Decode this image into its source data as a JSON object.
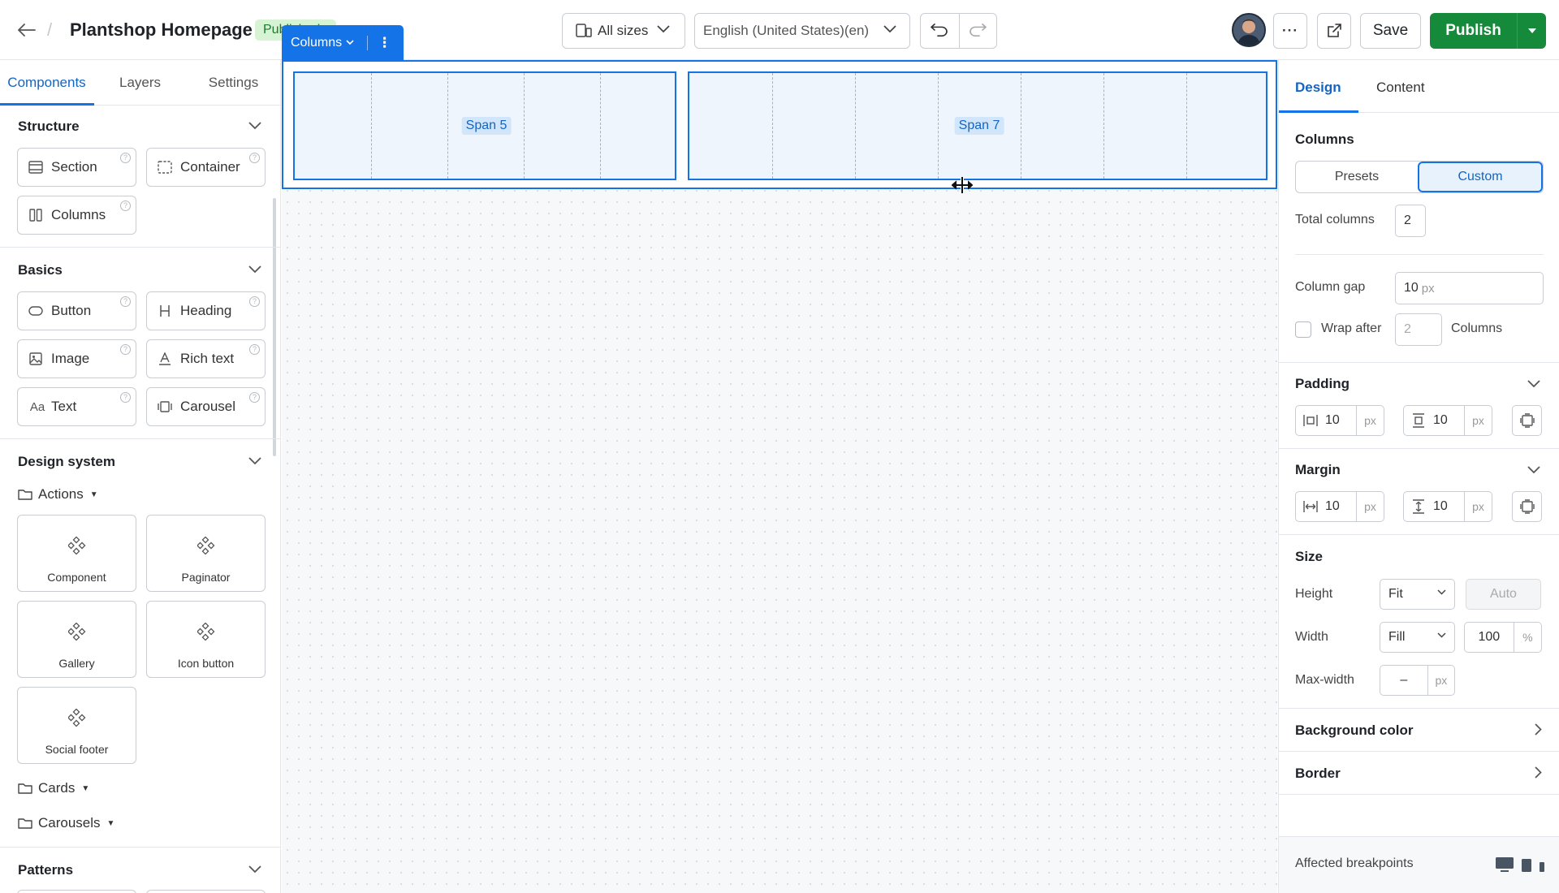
{
  "header": {
    "title": "Plantshop Homepage",
    "status": "Published",
    "selection_label": "Columns",
    "sizes": "All sizes",
    "language": "English (United States)(en)",
    "save": "Save",
    "publish": "Publish"
  },
  "left": {
    "tabs": [
      "Components",
      "Layers",
      "Settings"
    ],
    "structure": {
      "title": "Structure",
      "items": [
        "Section",
        "Container",
        "Columns"
      ]
    },
    "basics": {
      "title": "Basics",
      "items": [
        "Button",
        "Heading",
        "Image",
        "Rich text",
        "Text",
        "Carousel"
      ]
    },
    "design_system": {
      "title": "Design system",
      "folders": [
        "Actions",
        "Cards",
        "Carousels"
      ],
      "tiles": [
        "Component",
        "Paginator",
        "Gallery",
        "Icon button",
        "Social footer"
      ]
    },
    "patterns": {
      "title": "Patterns"
    }
  },
  "canvas": {
    "columns": [
      {
        "label": "Span 5",
        "span": 5
      },
      {
        "label": "Span 7",
        "span": 7
      }
    ]
  },
  "right": {
    "tabs": [
      "Design",
      "Content"
    ],
    "columns": {
      "title": "Columns",
      "modes": [
        "Presets",
        "Custom"
      ],
      "active_mode": "Custom",
      "total_label": "Total columns",
      "total_value": "2",
      "gap_label": "Column gap",
      "gap_value": "10",
      "gap_unit": "px",
      "wrap_label": "Wrap after",
      "wrap_value": "2",
      "wrap_suffix": "Columns"
    },
    "padding": {
      "title": "Padding",
      "horizontal": "10",
      "vertical": "10",
      "unit": "px"
    },
    "margin": {
      "title": "Margin",
      "horizontal": "10",
      "vertical": "10",
      "unit": "px"
    },
    "size": {
      "title": "Size",
      "height_label": "Height",
      "height_mode": "Fit",
      "height_value": "Auto",
      "width_label": "Width",
      "width_mode": "Fill",
      "width_value": "100",
      "width_unit": "%",
      "maxwidth_label": "Max-width",
      "maxwidth_value": "–",
      "maxwidth_unit": "px"
    },
    "background_color": "Background color",
    "border": "Border",
    "affected_breakpoints": "Affected breakpoints"
  },
  "colors": {
    "accent": "#1473e6",
    "publish": "#168a3b",
    "status_bg": "#d6f4d3"
  }
}
